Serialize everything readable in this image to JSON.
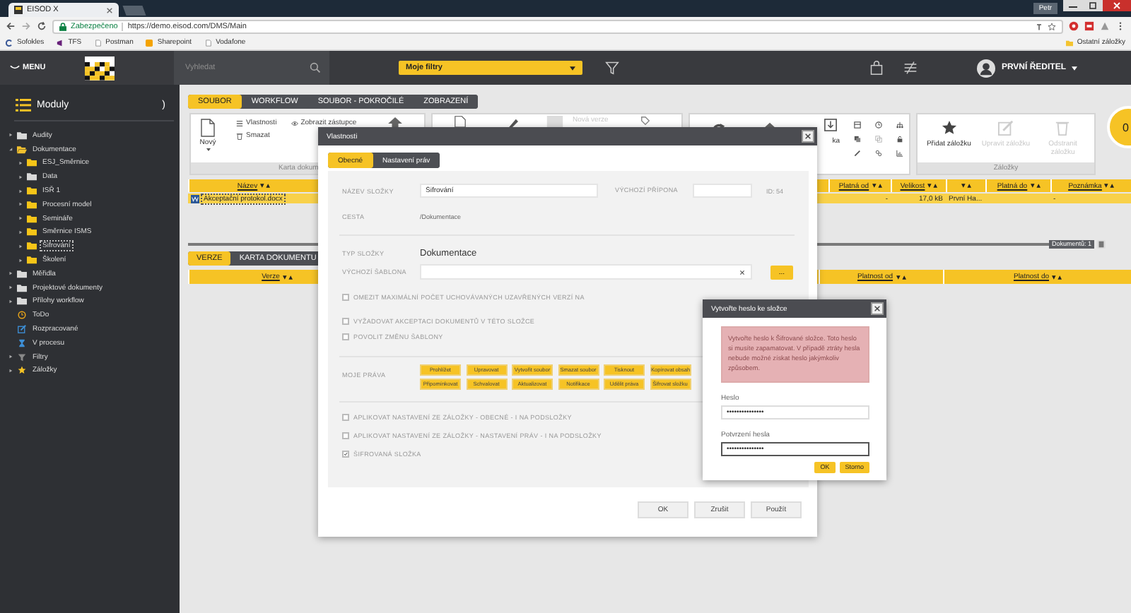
{
  "browser": {
    "tab_title": "EISOD X",
    "profile": "Petr",
    "security": "Zabezpečeno",
    "url": "https://demo.eisod.com/DMS/Main",
    "bookmarks": [
      {
        "label": "Sofokles",
        "kind": "letter"
      },
      {
        "label": "TFS",
        "kind": "studio"
      },
      {
        "label": "Postman",
        "kind": "page"
      },
      {
        "label": "Sharepoint",
        "kind": "tile"
      },
      {
        "label": "Vodafone",
        "kind": "page"
      }
    ],
    "other_bookmarks": "Ostatní záložky"
  },
  "header": {
    "menu_label": "MENU",
    "search": {
      "placeholder": "Vyhledat"
    },
    "filter": "Moje filtry",
    "user": "PRVNÍ ŘEDITEL"
  },
  "sidebar": {
    "title": "Moduly",
    "toggle": ")",
    "items": [
      {
        "label": "Audity",
        "kind": "folder",
        "color": "#d9d9d9",
        "expanded": false,
        "selected": false
      },
      {
        "label": "Dokumentace",
        "kind": "folder-open",
        "color": "#f2c12e",
        "expanded": true,
        "selected": false,
        "children": [
          {
            "label": "ESJ_Směrnice",
            "kind": "folder",
            "color": "#f5c518",
            "expanded": false,
            "selected": false
          },
          {
            "label": "Data",
            "kind": "folder",
            "color": "#d9d9d9",
            "expanded": false,
            "selected": false
          },
          {
            "label": "ISŘ 1",
            "kind": "folder",
            "color": "#f5c518",
            "expanded": false,
            "selected": false
          },
          {
            "label": "Procesní model",
            "kind": "folder",
            "color": "#f5c518",
            "expanded": false,
            "selected": false
          },
          {
            "label": "Semináře",
            "kind": "folder",
            "color": "#f5c518",
            "expanded": false,
            "selected": false
          },
          {
            "label": "Směrnice ISMS",
            "kind": "folder",
            "color": "#f5c518",
            "expanded": false,
            "selected": false
          },
          {
            "label": "Šifrování",
            "kind": "folder",
            "color": "#f5c518",
            "expanded": false,
            "selected": true
          },
          {
            "label": "Školení",
            "kind": "folder",
            "color": "#f5c518",
            "expanded": false,
            "selected": false
          }
        ]
      },
      {
        "label": "Měřidla",
        "kind": "folder",
        "color": "#d9d9d9",
        "expanded": false,
        "selected": false
      },
      {
        "label": "Projektové dokumenty",
        "kind": "folder",
        "color": "#d9d9d9",
        "expanded": false,
        "selected": false
      },
      {
        "label": "Přílohy workflow",
        "kind": "folder",
        "color": "#d9d9d9",
        "expanded": false,
        "selected": false
      },
      {
        "label": "ToDo",
        "kind": "todo",
        "selected": false
      },
      {
        "label": "Rozpracované",
        "kind": "edit",
        "selected": false
      },
      {
        "label": "V procesu",
        "kind": "hourglass",
        "selected": false
      },
      {
        "label": "Filtry",
        "kind": "filter",
        "expanded": false,
        "selected": false
      },
      {
        "label": "Záložky",
        "kind": "star",
        "expanded": false,
        "selected": false
      }
    ]
  },
  "ribbon": {
    "tabs": [
      {
        "label": "SOUBOR",
        "selected": true
      },
      {
        "label": "WORKFLOW",
        "selected": false
      },
      {
        "label": "SOUBOR - POKROČILÉ",
        "selected": false
      },
      {
        "label": "ZOBRAZENÍ",
        "selected": false
      }
    ],
    "new_button": "Nový",
    "small_buttons": [
      {
        "label": "Vlastnosti",
        "kind": "list"
      },
      {
        "label": "Smazat",
        "kind": "trash"
      },
      {
        "label": "Zobrazit zástupce",
        "kind": "eye"
      }
    ],
    "document_caption": "Karta dokum",
    "version_button": {
      "label": "Nová verze",
      "disabled": true
    },
    "tools_label": "ka",
    "bookmark_buttons": [
      {
        "label": "Přidat záložku",
        "kind": "star",
        "disabled": false
      },
      {
        "label": "Upravit záložku",
        "kind": "edit",
        "disabled": true
      },
      {
        "label": "Odstranit záložku",
        "kind": "trash",
        "disabled": true
      }
    ],
    "bookmark_caption": "Záložky"
  },
  "notification_count": "0",
  "documents_table": {
    "name_column": "Název",
    "columns": [
      {
        "label": "Platná od"
      },
      {
        "label": "Velikost"
      },
      {},
      {
        "label": "Platná do"
      },
      {
        "label": "Poznámka"
      }
    ],
    "rows": [
      {
        "name": "Akceptační protokol.docx",
        "kind": "word",
        "cells": [
          {
            "text": "-"
          },
          {
            "text": "17,0 kB"
          },
          {
            "text": "První Ha..."
          },
          {},
          {
            "text": "-"
          }
        ]
      }
    ]
  },
  "count_badge": "Dokumentů: 1",
  "detail_tabs": [
    {
      "label": "VERZE",
      "selected": true
    },
    {
      "label": "KARTA DOKUMENTU",
      "selected": false
    }
  ],
  "versions_table": {
    "name_column": "Verze",
    "columns": [
      "Platnost od",
      "Platnost do"
    ]
  },
  "properties_dialog": {
    "title": "Vlastnosti",
    "tabs": [
      {
        "label": "Obecné",
        "selected": true
      },
      {
        "label": "Nastavení práv",
        "selected": false
      }
    ],
    "folder_name": {
      "label": "NÁZEV SLOŽKY",
      "value": "Šifrování"
    },
    "default_extension": {
      "label": "VÝCHOZÍ PŘÍPONA"
    },
    "id": "ID: 54",
    "path": {
      "label": "CESTA",
      "value": "/Dokumentace"
    },
    "folder_type": {
      "label": "TYP SLOŽKY",
      "value": "Dokumentace"
    },
    "default_template": {
      "label": "VÝCHOZÍ ŠABLONA",
      "browse": "..."
    },
    "options": [
      {
        "label": "OMEZIT MAXIMÁLNÍ POČET UCHOVÁVANÝCH UZAVŘENÝCH VERZÍ NA",
        "checked": false
      },
      {
        "label": "VYŽADOVAT AKCEPTACI DOKUMENTŮ V TÉTO SLOŽCE",
        "checked": false
      },
      {
        "label": "POVOLIT ZMĚNU ŠABLONY",
        "checked": false
      }
    ],
    "rights": {
      "label": "MOJE PRÁVA",
      "items": [
        "Prohlížet",
        "Upravovat",
        "Vytvořit soubor",
        "Smazat soubor",
        "Tisknout",
        "Kopírovat obsah",
        "Připomínkovat",
        "Schvalovat",
        "Aktualizovat",
        "Notifikace",
        "Udělit práva",
        "Šifrovat složku"
      ]
    },
    "apply_options": [
      {
        "label": "APLIKOVAT NASTAVENÍ ZE ZÁLOŽKY - OBECNÉ - I NA PODSLOŽKY",
        "checked": false
      },
      {
        "label": "APLIKOVAT NASTAVENÍ ZE ZÁLOŽKY - NASTAVENÍ PRÁV - I NA PODSLOŽKY",
        "checked": false
      },
      {
        "label": "ŠIFROVANÁ SLOŽKA",
        "checked": true
      }
    ],
    "buttons": [
      "OK",
      "Zrušit",
      "Použít"
    ]
  },
  "password_dialog": {
    "title": "Vytvořte heslo ke složce",
    "message": "Vytvořte heslo k Šifrované složce. Toto heslo si musíte zapamatovat. V případě ztráty hesla nebude možné získat heslo jakýmkoliv způsobem.",
    "fields": [
      {
        "label": "Heslo",
        "value": "•••••••••••••••",
        "focused": false
      },
      {
        "label": "Potvrzení hesla",
        "value": "•••••••••••••••",
        "focused": true
      }
    ],
    "buttons": [
      "OK",
      "Storno"
    ]
  }
}
